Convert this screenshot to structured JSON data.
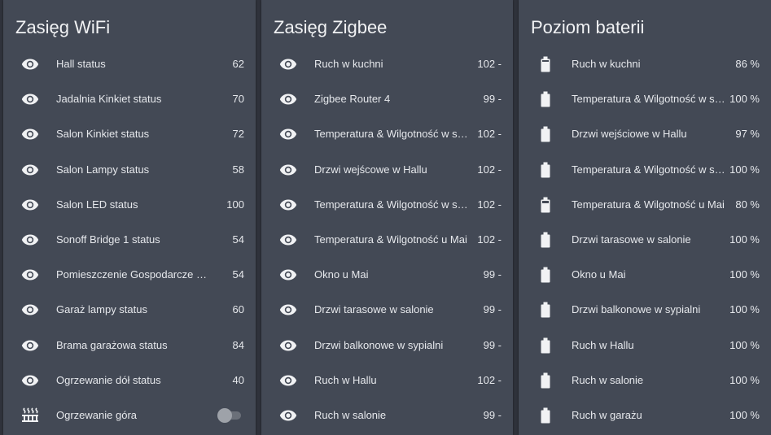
{
  "wifi": {
    "title": "Zasięg WiFi",
    "rows": [
      {
        "name": "Hall status",
        "value": "62",
        "icon": "eye-icon"
      },
      {
        "name": "Jadalnia Kinkiet status",
        "value": "70",
        "icon": "eye-icon"
      },
      {
        "name": "Salon Kinkiet status",
        "value": "72",
        "icon": "eye-icon"
      },
      {
        "name": "Salon Lampy status",
        "value": "58",
        "icon": "eye-icon"
      },
      {
        "name": "Salon LED status",
        "value": "100",
        "icon": "eye-icon"
      },
      {
        "name": "Sonoff Bridge 1 status",
        "value": "54",
        "icon": "eye-icon"
      },
      {
        "name": "Pomieszczenie Gospodarcze Lampy status",
        "value": "54",
        "icon": "eye-icon"
      },
      {
        "name": "Garaż lampy status",
        "value": "60",
        "icon": "eye-icon"
      },
      {
        "name": "Brama garażowa status",
        "value": "84",
        "icon": "eye-icon"
      },
      {
        "name": "Ogrzewanie dół status",
        "value": "40",
        "icon": "eye-icon"
      }
    ],
    "toggle_row": {
      "name": "Ogrzewanie góra",
      "icon": "radiator-icon",
      "state": "off"
    }
  },
  "zigbee": {
    "title": "Zasięg Zigbee",
    "rows": [
      {
        "name": "Ruch w kuchni",
        "value": "102 -",
        "icon": "eye-icon"
      },
      {
        "name": "Zigbee Router 4",
        "value": "99 -",
        "icon": "eye-icon"
      },
      {
        "name": "Temperatura & Wilgotność w salonie",
        "value": "102 -",
        "icon": "eye-icon"
      },
      {
        "name": "Drzwi wejścowe w Hallu",
        "value": "102 -",
        "icon": "eye-icon"
      },
      {
        "name": "Temperatura & Wilgotność w sypialni",
        "value": "102 -",
        "icon": "eye-icon"
      },
      {
        "name": "Temperatura & Wilgotność u Mai",
        "value": "102 -",
        "icon": "eye-icon"
      },
      {
        "name": "Okno u Mai",
        "value": "99 -",
        "icon": "eye-icon"
      },
      {
        "name": "Drzwi tarasowe w salonie",
        "value": "99 -",
        "icon": "eye-icon"
      },
      {
        "name": "Drzwi balkonowe w sypialni",
        "value": "99 -",
        "icon": "eye-icon"
      },
      {
        "name": "Ruch w Hallu",
        "value": "102 -",
        "icon": "eye-icon"
      },
      {
        "name": "Ruch w salonie",
        "value": "99 -",
        "icon": "eye-icon"
      }
    ]
  },
  "battery": {
    "title": "Poziom baterii",
    "rows": [
      {
        "name": "Ruch w kuchni",
        "value": "86 %",
        "level": 86,
        "icon": "battery-icon"
      },
      {
        "name": "Temperatura & Wilgotność w salonie",
        "value": "100 %",
        "level": 100,
        "icon": "battery-icon"
      },
      {
        "name": "Drzwi wejściowe w Hallu",
        "value": "97 %",
        "level": 97,
        "icon": "battery-icon"
      },
      {
        "name": "Temperatura & Wilgotność w sypialni",
        "value": "100 %",
        "level": 100,
        "icon": "battery-icon"
      },
      {
        "name": "Temperatura & Wilgotność u Mai",
        "value": "80 %",
        "level": 80,
        "icon": "battery-icon"
      },
      {
        "name": "Drzwi tarasowe w salonie",
        "value": "100 %",
        "level": 100,
        "icon": "battery-icon"
      },
      {
        "name": "Okno u Mai",
        "value": "100 %",
        "level": 100,
        "icon": "battery-icon"
      },
      {
        "name": "Drzwi balkonowe w sypialni",
        "value": "100 %",
        "level": 100,
        "icon": "battery-icon"
      },
      {
        "name": "Ruch w Hallu",
        "value": "100 %",
        "level": 100,
        "icon": "battery-icon"
      },
      {
        "name": "Ruch w salonie",
        "value": "100 %",
        "level": 100,
        "icon": "battery-icon"
      },
      {
        "name": "Ruch w garażu",
        "value": "100 %",
        "level": 100,
        "icon": "battery-icon"
      }
    ]
  },
  "colors": {
    "background": "#2f323b",
    "card": "#434955",
    "text": "#e6e8ec",
    "icon": "#f1f2f4"
  }
}
